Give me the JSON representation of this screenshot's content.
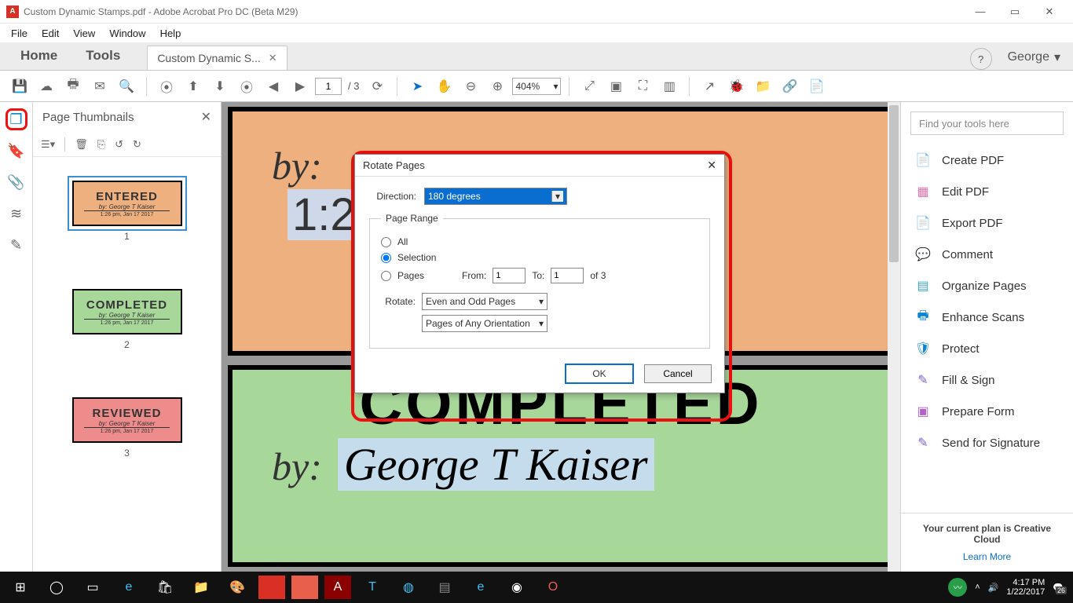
{
  "window": {
    "title": "Custom Dynamic Stamps.pdf - Adobe Acrobat Pro DC (Beta M29)",
    "controls": {
      "minimize": "—",
      "maximize": "▭",
      "close": "✕"
    }
  },
  "menubar": [
    "File",
    "Edit",
    "View",
    "Window",
    "Help"
  ],
  "tabbar": {
    "home": "Home",
    "tools": "Tools",
    "doc_tab": "Custom Dynamic S...",
    "user": "George"
  },
  "toolbar": {
    "page_current": "1",
    "page_total": "/ 3",
    "zoom": "404%"
  },
  "thumbnails": {
    "title": "Page Thumbnails",
    "items": [
      {
        "title": "ENTERED",
        "by": "by: George T Kaiser",
        "date": "1:26 pm, Jan 17 2017",
        "num": "1",
        "bg": "#eeb07e",
        "selected": true
      },
      {
        "title": "COMPLETED",
        "by": "by: George T Kaiser",
        "date": "1:26 pm, Jan 17 2017",
        "num": "2",
        "bg": "#a8d79a",
        "selected": false
      },
      {
        "title": "REVIEWED",
        "by": "by: George T Kaiser",
        "date": "1:26 pm, Jan 17 2017",
        "num": "3",
        "bg": "#ee8b8b",
        "selected": false
      }
    ]
  },
  "document": {
    "page1": {
      "title": "ENTERED",
      "by_label": "by:",
      "by_name": "George T Kaiser",
      "date_prefix": "1:2"
    },
    "page2": {
      "title": "COMPLETED",
      "by_label": "by:",
      "by_name": "George T Kaiser"
    }
  },
  "right_panel": {
    "search_placeholder": "Find your tools here",
    "items": [
      {
        "label": "Create PDF",
        "color": "#e8604c",
        "glyph": "📄"
      },
      {
        "label": "Edit PDF",
        "color": "#e974b2",
        "glyph": "▦"
      },
      {
        "label": "Export PDF",
        "color": "#2aa36f",
        "glyph": "📄"
      },
      {
        "label": "Comment",
        "color": "#f2b200",
        "glyph": "💬"
      },
      {
        "label": "Organize Pages",
        "color": "#3aa6d0",
        "glyph": "▤"
      },
      {
        "label": "Enhance Scans",
        "color": "#0a84d6",
        "glyph": "🖶"
      },
      {
        "label": "Protect",
        "color": "#0a84d6",
        "glyph": "🛡"
      },
      {
        "label": "Fill & Sign",
        "color": "#7a5fd0",
        "glyph": "✎"
      },
      {
        "label": "Prepare Form",
        "color": "#b85fd0",
        "glyph": "▣"
      },
      {
        "label": "Send for Signature",
        "color": "#7a5fd0",
        "glyph": "✎"
      }
    ],
    "plan_title": "Your current plan is Creative Cloud",
    "plan_link": "Learn More"
  },
  "dialog": {
    "title": "Rotate Pages",
    "direction_label": "Direction:",
    "direction_value": "180 degrees",
    "range_legend": "Page Range",
    "radio_all": "All",
    "radio_selection": "Selection",
    "radio_pages": "Pages",
    "from_label": "From:",
    "from_value": "1",
    "to_label": "To:",
    "to_value": "1",
    "of_label": "of 3",
    "rotate_label": "Rotate:",
    "rotate_value": "Even and Odd Pages",
    "orientation_value": "Pages of Any Orientation",
    "ok": "OK",
    "cancel": "Cancel"
  },
  "taskbar": {
    "time": "4:17 PM",
    "date": "1/22/2017",
    "notif_count": "26"
  }
}
